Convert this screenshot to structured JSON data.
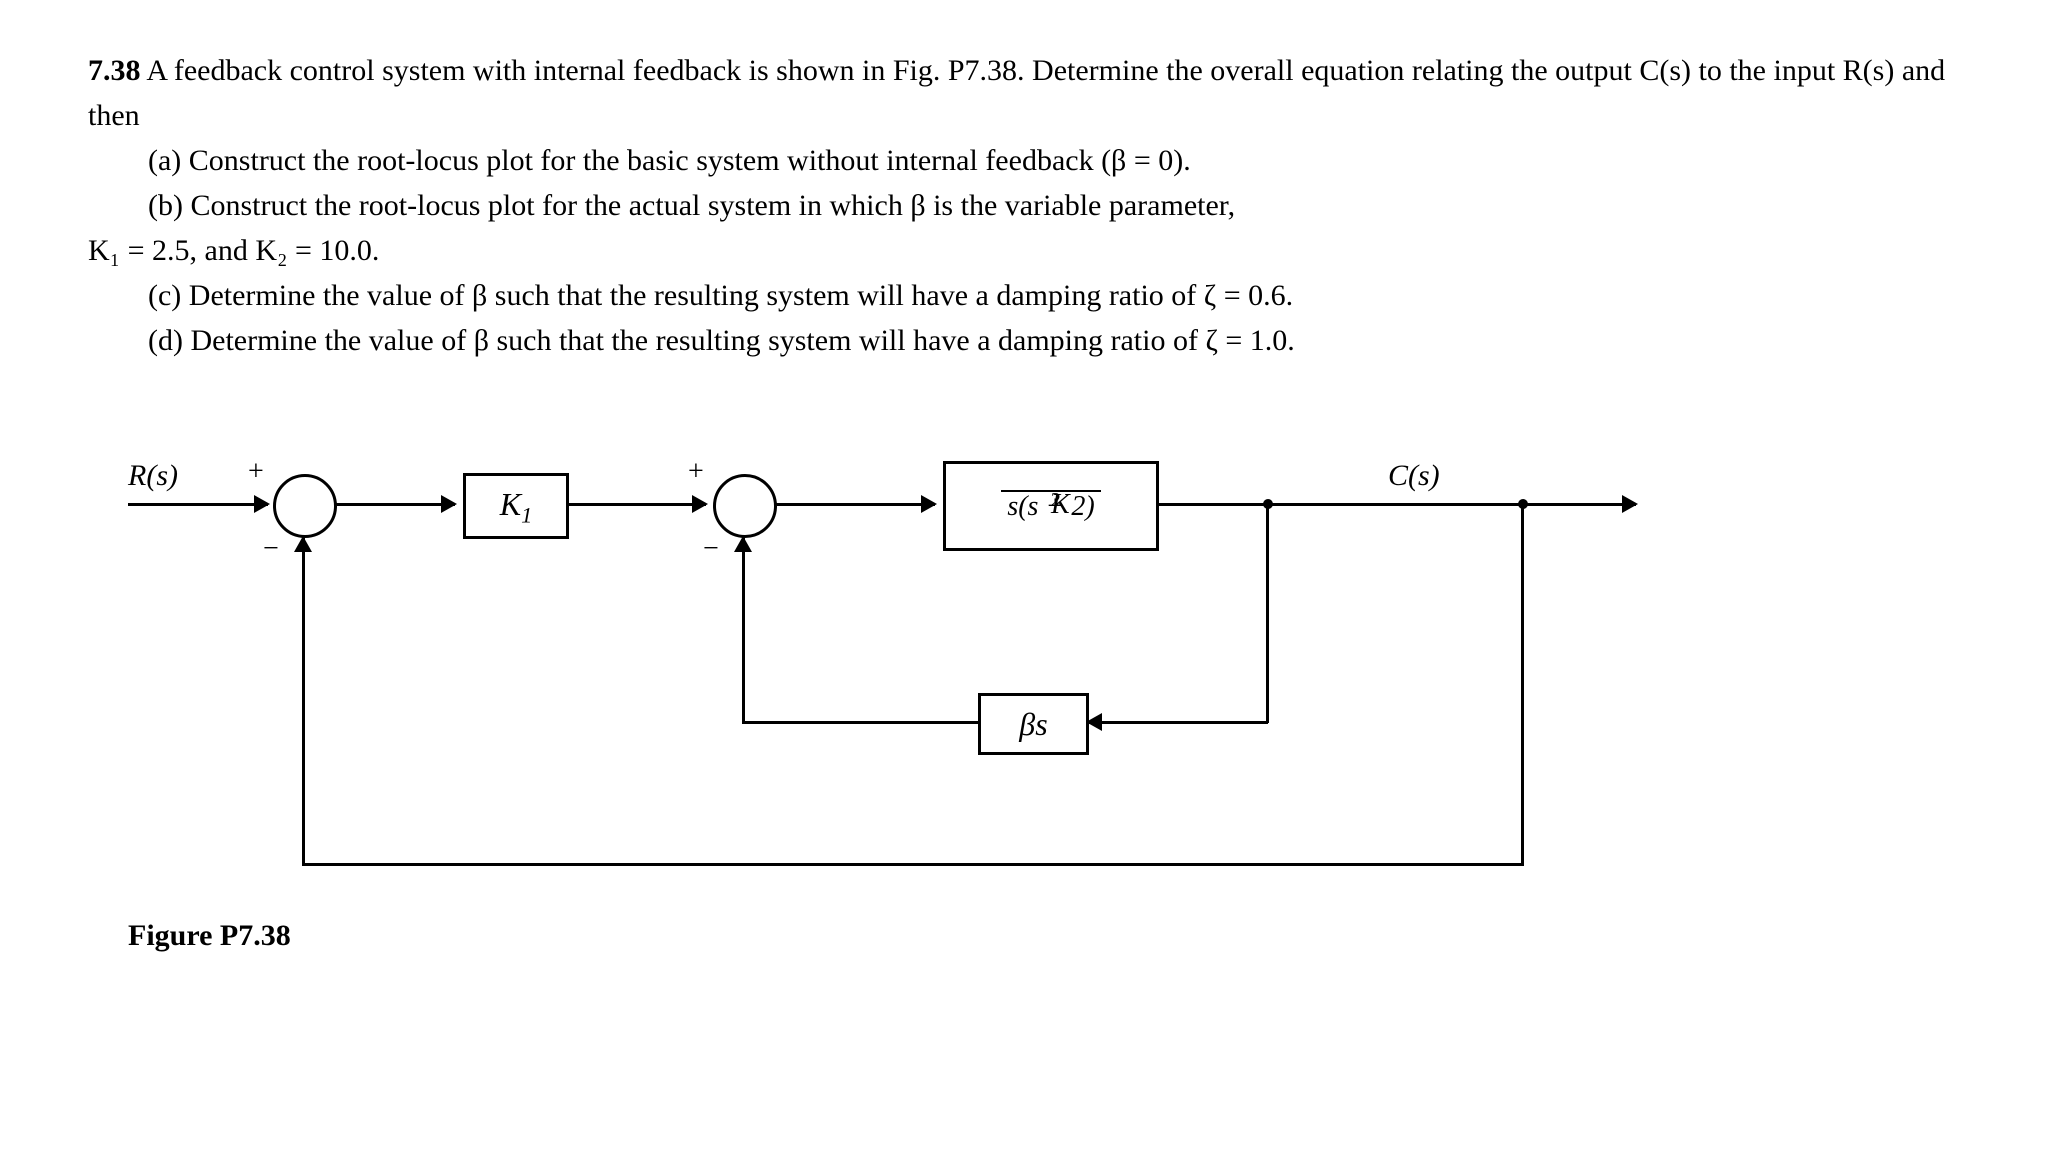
{
  "problem": {
    "number": "7.38",
    "intro": "A feedback control system with internal feedback is shown in Fig. P7.38. Determine the overall equation relating the output C(s) to the input R(s) and then",
    "parts": {
      "a": "(a) Construct the root-locus plot for the basic system without internal feedback (β = 0).",
      "b": "(b) Construct the root-locus plot for the actual system in which β is the variable parameter,",
      "b_cont": "K₁ = 2.5, and K₂ = 10.0.",
      "c": "(c) Determine the value of β such that the resulting system will have a damping ratio of ζ = 0.6.",
      "d": "(d) Determine the value of β such that the resulting system will have a damping ratio of ζ = 1.0."
    }
  },
  "diagram": {
    "input": "R(s)",
    "output": "C(s)",
    "sum1_plus": "+",
    "sum1_minus": "−",
    "sum2_plus": "+",
    "sum2_minus": "−",
    "k1": "K",
    "k1_sub": "1",
    "g_num": "K",
    "g_num_sub": "2",
    "g_den": "s(s + 2)",
    "feedback_inner": "βs",
    "caption": "Figure P7.38"
  }
}
